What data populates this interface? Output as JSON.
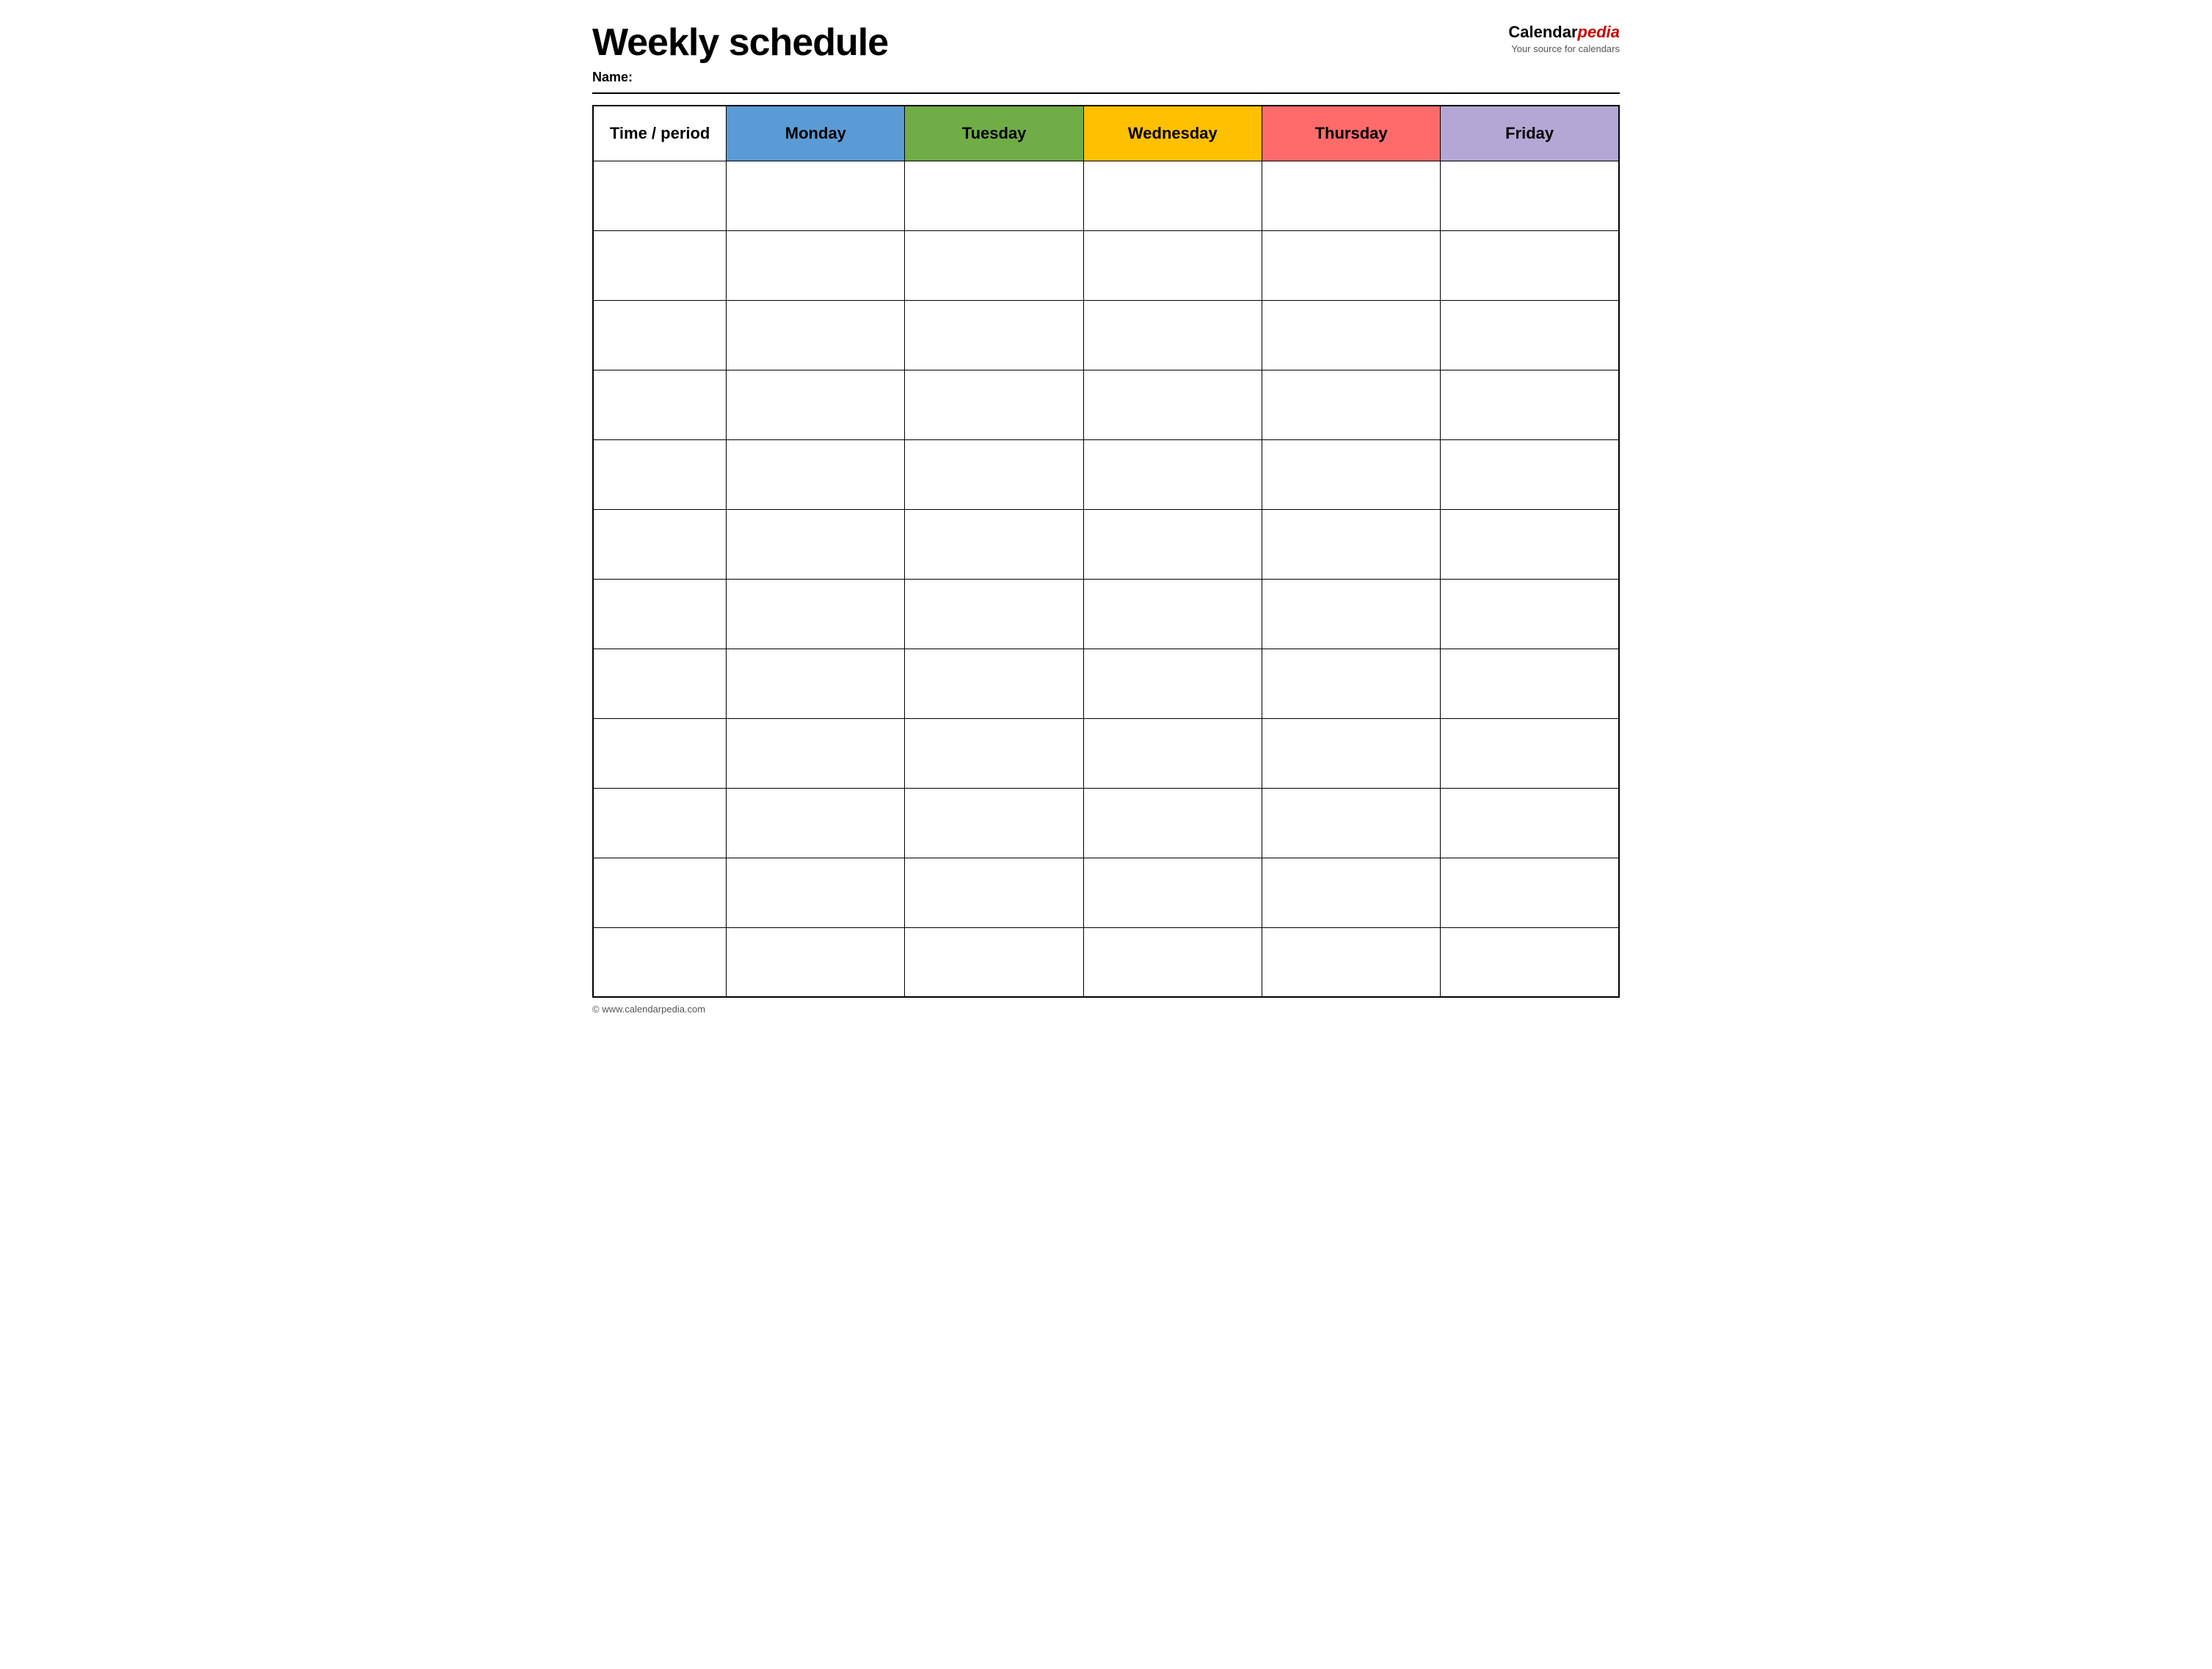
{
  "header": {
    "title": "Weekly schedule",
    "name_label": "Name:",
    "logo_text": "Calendar",
    "logo_italic": "pedia",
    "logo_tagline": "Your source for calendars",
    "footer": "© www.calendarpedia.com"
  },
  "table": {
    "columns": [
      {
        "key": "time",
        "label": "Time / period",
        "color": "#ffffff"
      },
      {
        "key": "monday",
        "label": "Monday",
        "color": "#5b9bd5"
      },
      {
        "key": "tuesday",
        "label": "Tuesday",
        "color": "#70ad47"
      },
      {
        "key": "wednesday",
        "label": "Wednesday",
        "color": "#ffc000"
      },
      {
        "key": "thursday",
        "label": "Thursday",
        "color": "#ff6b6b"
      },
      {
        "key": "friday",
        "label": "Friday",
        "color": "#b4a7d6"
      }
    ],
    "row_count": 12
  }
}
